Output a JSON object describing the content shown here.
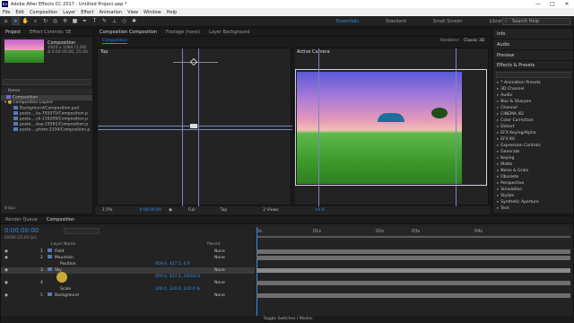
{
  "window": {
    "title": "Adobe After Effects CC 2017 - Untitled Project.aep *",
    "logo": "Ae",
    "controls": [
      "—",
      "□",
      "✕"
    ]
  },
  "menu": [
    "File",
    "Edit",
    "Composition",
    "Layer",
    "Effect",
    "Animation",
    "View",
    "Window",
    "Help"
  ],
  "workspaces": {
    "essentials": "Essentials",
    "standard": "Standard",
    "small_screen": "Small Screen",
    "libraries": "Libraries"
  },
  "search_help": "Search Help",
  "project": {
    "tab_project": "Project",
    "tab_effect_controls": "Effect Controls: SE",
    "comp_name": "Composition",
    "comp_size": "1920 x 1080 (1.00)",
    "comp_duration": "Δ 0:00:05:00, 25.00",
    "name_header": "Name",
    "items": [
      "Composition",
      "Composition Layers",
      "Background/Composition.psd",
      "poste....ks-705075/Composition.p",
      "poste....ck-116209/Composition.p",
      "poste....bay-19561/Composition.p",
      "poste....photo-2334/Composition.p"
    ],
    "bpc": "8 bpc"
  },
  "viewer": {
    "tab_composition": "Composition Composition",
    "tab_footage": "Footage (none)",
    "tab_layer": "Layer Background",
    "comp_label": "Composition",
    "renderer": "Renderer:",
    "renderer_value": "Classic 3D",
    "left_view": "Top",
    "right_view": "Active Camera",
    "zoom": "1.5%",
    "timecode": "0:00:00:00",
    "resolution": "Full",
    "view_select": "Top",
    "views": "2 Views",
    "exposure": "+0.0"
  },
  "right_panels": {
    "info": "Info",
    "audio": "Audio",
    "preview": "Preview",
    "effects_presets": "Effects & Presets",
    "search_placeholder": "",
    "categories": [
      "* Animation Presets",
      "3D Channel",
      "Audio",
      "Blur & Sharpen",
      "Channel",
      "CINEMA 4D",
      "Color Correction",
      "Distort",
      "EFX Keying/Alpha",
      "EFX Kit",
      "Expression Controls",
      "Generate",
      "Keying",
      "Matte",
      "Noise & Grain",
      "Obsolete",
      "Perspective",
      "Simulation",
      "Stylize",
      "Synthetic Aperture",
      "Text"
    ]
  },
  "timeline": {
    "tab_render_queue": "Render Queue",
    "tab_composition": "Composition",
    "timecode": "0:00:00:00",
    "timecode_sub": "00000 (25.00 fps)",
    "col_layer_name": "Layer Name",
    "col_parent": "Parent",
    "ruler_marks": [
      "0s",
      "01s",
      "02s",
      "03s",
      "04s"
    ],
    "layers": [
      {
        "num": "1",
        "name": "Field",
        "parent": "None"
      },
      {
        "num": "2",
        "name": "Mountain",
        "parent": "None"
      },
      {
        "num": "",
        "name": "Position",
        "value": "959.0, 457.5, 0.0"
      },
      {
        "num": "3",
        "name": "Sky",
        "parent": "None"
      },
      {
        "num": "",
        "name": "Position",
        "value": "959.0, 457.5, 10000.0"
      },
      {
        "num": "4",
        "name": "",
        "parent": "None"
      },
      {
        "num": "",
        "name": "Scale",
        "value": "100.0, 220.0, 220.0 %"
      },
      {
        "num": "5",
        "name": "Background",
        "parent": "None"
      }
    ],
    "toggle": "Toggle Switches / Modes"
  },
  "colors": {
    "accent": "#2d8ceb",
    "panel": "#232323",
    "dark": "#1d1d1d",
    "highlight": "#e8c13a"
  }
}
